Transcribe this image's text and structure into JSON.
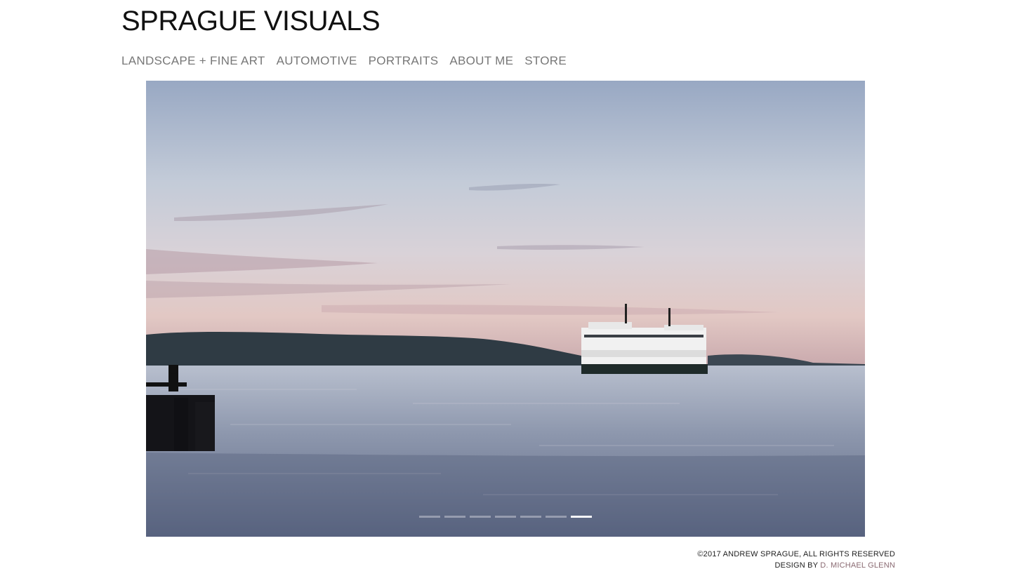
{
  "site": {
    "title": "SPRAGUE VISUALS"
  },
  "nav": {
    "items": [
      {
        "label": "LANDSCAPE + FINE ART"
      },
      {
        "label": "AUTOMOTIVE"
      },
      {
        "label": "PORTRAITS"
      },
      {
        "label": "ABOUT ME"
      },
      {
        "label": "STORE"
      }
    ]
  },
  "slideshow": {
    "slide_count": 7,
    "active_index": 6,
    "image_subject": "ferry-on-water-at-dusk"
  },
  "footer": {
    "copyright": "©2017 ANDREW SPRAGUE, ALL RIGHTS RESERVED",
    "design_prefix": "DESIGN BY ",
    "designer": "D. MICHAEL GLENN"
  },
  "colors": {
    "title": "#111111",
    "nav": "#777777",
    "designer_link": "#8a6a72"
  }
}
